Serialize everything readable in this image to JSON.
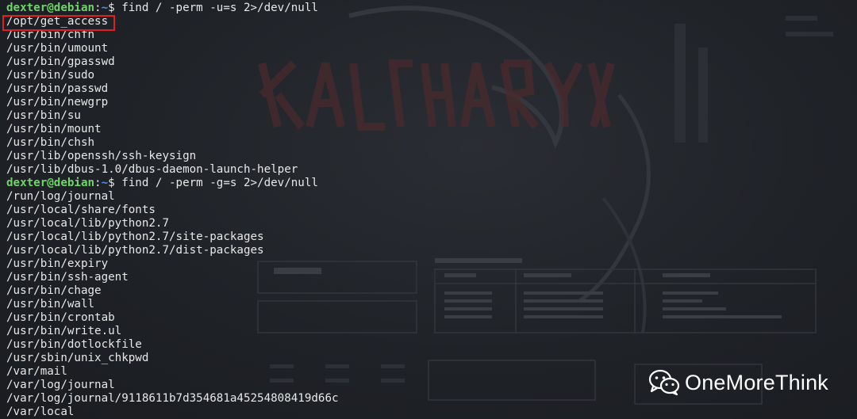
{
  "terminal": {
    "prompt_user": "dexter@debian",
    "prompt_sep": ":",
    "prompt_dir": "~",
    "prompt_symbol": "$",
    "lines": [
      {
        "type": "prompt",
        "command": " find / -perm -u=s 2>/dev/null"
      },
      {
        "type": "output",
        "text": "/opt/get_access",
        "highlighted": true
      },
      {
        "type": "output",
        "text": "/usr/bin/chfn"
      },
      {
        "type": "output",
        "text": "/usr/bin/umount"
      },
      {
        "type": "output",
        "text": "/usr/bin/gpasswd"
      },
      {
        "type": "output",
        "text": "/usr/bin/sudo"
      },
      {
        "type": "output",
        "text": "/usr/bin/passwd"
      },
      {
        "type": "output",
        "text": "/usr/bin/newgrp"
      },
      {
        "type": "output",
        "text": "/usr/bin/su"
      },
      {
        "type": "output",
        "text": "/usr/bin/mount"
      },
      {
        "type": "output",
        "text": "/usr/bin/chsh"
      },
      {
        "type": "output",
        "text": "/usr/lib/openssh/ssh-keysign"
      },
      {
        "type": "output",
        "text": "/usr/lib/dbus-1.0/dbus-daemon-launch-helper"
      },
      {
        "type": "prompt",
        "command": " find / -perm -g=s 2>/dev/null"
      },
      {
        "type": "output",
        "text": "/run/log/journal"
      },
      {
        "type": "output",
        "text": "/usr/local/share/fonts"
      },
      {
        "type": "output",
        "text": "/usr/local/lib/python2.7"
      },
      {
        "type": "output",
        "text": "/usr/local/lib/python2.7/site-packages"
      },
      {
        "type": "output",
        "text": "/usr/local/lib/python2.7/dist-packages"
      },
      {
        "type": "output",
        "text": "/usr/bin/expiry"
      },
      {
        "type": "output",
        "text": "/usr/bin/ssh-agent"
      },
      {
        "type": "output",
        "text": "/usr/bin/chage"
      },
      {
        "type": "output",
        "text": "/usr/bin/wall"
      },
      {
        "type": "output",
        "text": "/usr/bin/crontab"
      },
      {
        "type": "output",
        "text": "/usr/bin/write.ul"
      },
      {
        "type": "output",
        "text": "/usr/bin/dotlockfile"
      },
      {
        "type": "output",
        "text": "/usr/sbin/unix_chkpwd"
      },
      {
        "type": "output",
        "text": "/var/mail"
      },
      {
        "type": "output",
        "text": "/var/log/journal"
      },
      {
        "type": "output",
        "text": "/var/log/journal/9118611b7d354681a45254808419d66c"
      },
      {
        "type": "output",
        "text": "/var/local"
      }
    ]
  },
  "watermark": {
    "text": "OneMoreThink",
    "icon": "wechat-icon"
  },
  "colors": {
    "background": "#1f2227",
    "user": "#6fd46a",
    "directory": "#5a8dee",
    "text": "#e8e8e8",
    "highlight_box": "#e02020"
  }
}
